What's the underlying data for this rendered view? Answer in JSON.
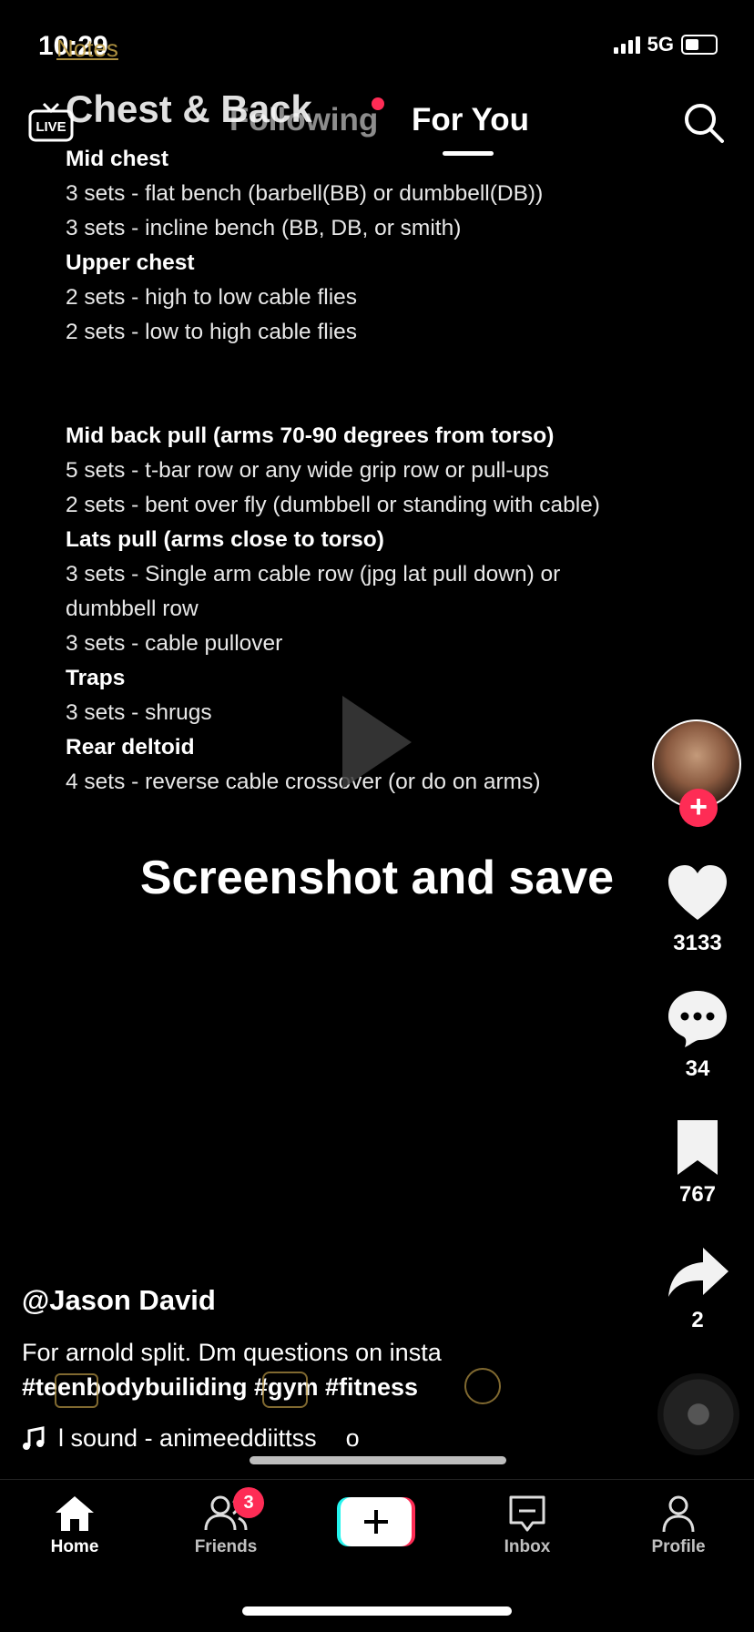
{
  "status": {
    "time": "10:29",
    "back_label": "Notes",
    "network": "5G"
  },
  "top_nav": {
    "following": "Following",
    "for_you": "For You"
  },
  "note_title": "Chest & Back",
  "notes": [
    {
      "text": "Mid chest",
      "bold": true
    },
    {
      "text": "3 sets - flat bench (barbell(BB) or dumbbell(DB))",
      "bold": false
    },
    {
      "text": "3 sets - incline bench (BB, DB, or smith)",
      "bold": false
    },
    {
      "text": "Upper chest",
      "bold": true
    },
    {
      "text": "2 sets - high to low cable flies",
      "bold": false
    },
    {
      "text": "2 sets - low to high cable flies",
      "bold": false
    },
    {
      "text": "",
      "gap": true
    },
    {
      "text": "Mid back pull (arms 70-90 degrees from torso)",
      "bold": true
    },
    {
      "text": "5 sets - t-bar row or any wide grip row or pull-ups",
      "bold": false
    },
    {
      "text": "2 sets - bent over fly (dumbbell or standing with cable)",
      "bold": false
    },
    {
      "text": "Lats pull (arms close to torso)",
      "bold": true
    },
    {
      "text": "3 sets - Single arm cable row (jpg lat pull down) or",
      "bold": false
    },
    {
      "text": "dumbbell row",
      "bold": false
    },
    {
      "text": "3 sets - cable pullover",
      "bold": false
    },
    {
      "text": "Traps",
      "bold": true
    },
    {
      "text": "3 sets - shrugs",
      "bold": false
    },
    {
      "text": "Rear deltoid",
      "bold": true
    },
    {
      "text": "4 sets - reverse cable crossover (or do on arms)",
      "bold": false
    }
  ],
  "overlay_text": "Screenshot and save",
  "rail": {
    "likes": "3133",
    "comments": "34",
    "saves": "767",
    "shares": "2"
  },
  "post": {
    "username": "@Jason David",
    "caption": "For arnold split. Dm questions on insta",
    "hashtags": "#teenbodybuiliding #gym #fitness",
    "sound": "l sound - animeeddiittss",
    "sound_tail": "o"
  },
  "tabbar": {
    "home": "Home",
    "friends": "Friends",
    "friends_badge": "3",
    "inbox": "Inbox",
    "profile": "Profile"
  },
  "colors": {
    "accent": "#fe2c55",
    "cyan": "#25f4ee",
    "notes_ghost": "#b69545"
  }
}
